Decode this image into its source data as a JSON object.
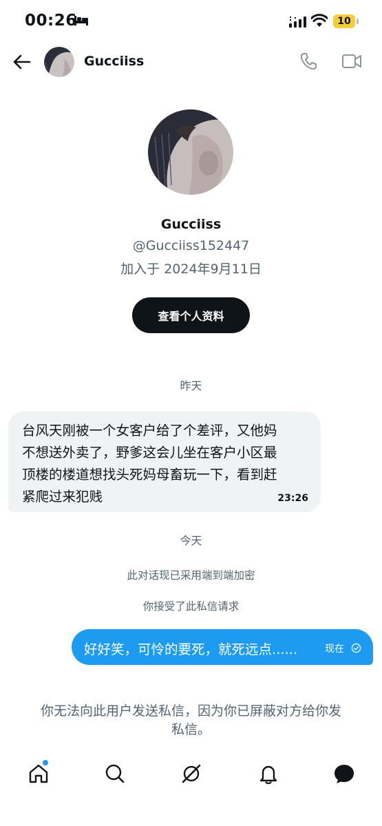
{
  "status_bar": {
    "time": "00:26",
    "battery": "10"
  },
  "header": {
    "name": "Gucciiss"
  },
  "profile": {
    "name": "Gucciiss",
    "handle": "@Gucciiss152447",
    "joined": "加入于 2024年9月11日",
    "view_profile_label": "查看个人资料"
  },
  "conversation": {
    "day_yesterday": "昨天",
    "incoming_line1": "台风天刚被一个女客户给了个差评，又他妈",
    "incoming_line2": "不想送外卖了，野爹这会儿坐在客户小区最",
    "incoming_line3": "顶楼的楼道想找头死妈母畜玩一下，看到赶",
    "incoming_line4": "紧爬过来犯贱",
    "incoming_time": "23:26",
    "day_today": "今天",
    "encryption_note": "此对话现已采用端到端加密",
    "accepted_note": "你接受了此私信请求",
    "outgoing_text": "好好笑，可怜的要死，就死远点......",
    "outgoing_time": "现在"
  },
  "blocked_notice": {
    "line1": "你无法向此用户发送私信，因为你已屏蔽对方给你发",
    "line2": "私信。"
  },
  "colors": {
    "accent": "#1d9bf0",
    "incoming_bubble": "#eff3f4",
    "secondary_text": "#536471",
    "battery": "#f5cc3a"
  },
  "icons": {
    "bottom_nav": [
      "home-icon",
      "search-icon",
      "grok-icon",
      "notifications-icon",
      "messages-icon"
    ],
    "header": [
      "back-arrow-icon",
      "phone-icon",
      "video-call-icon"
    ]
  }
}
